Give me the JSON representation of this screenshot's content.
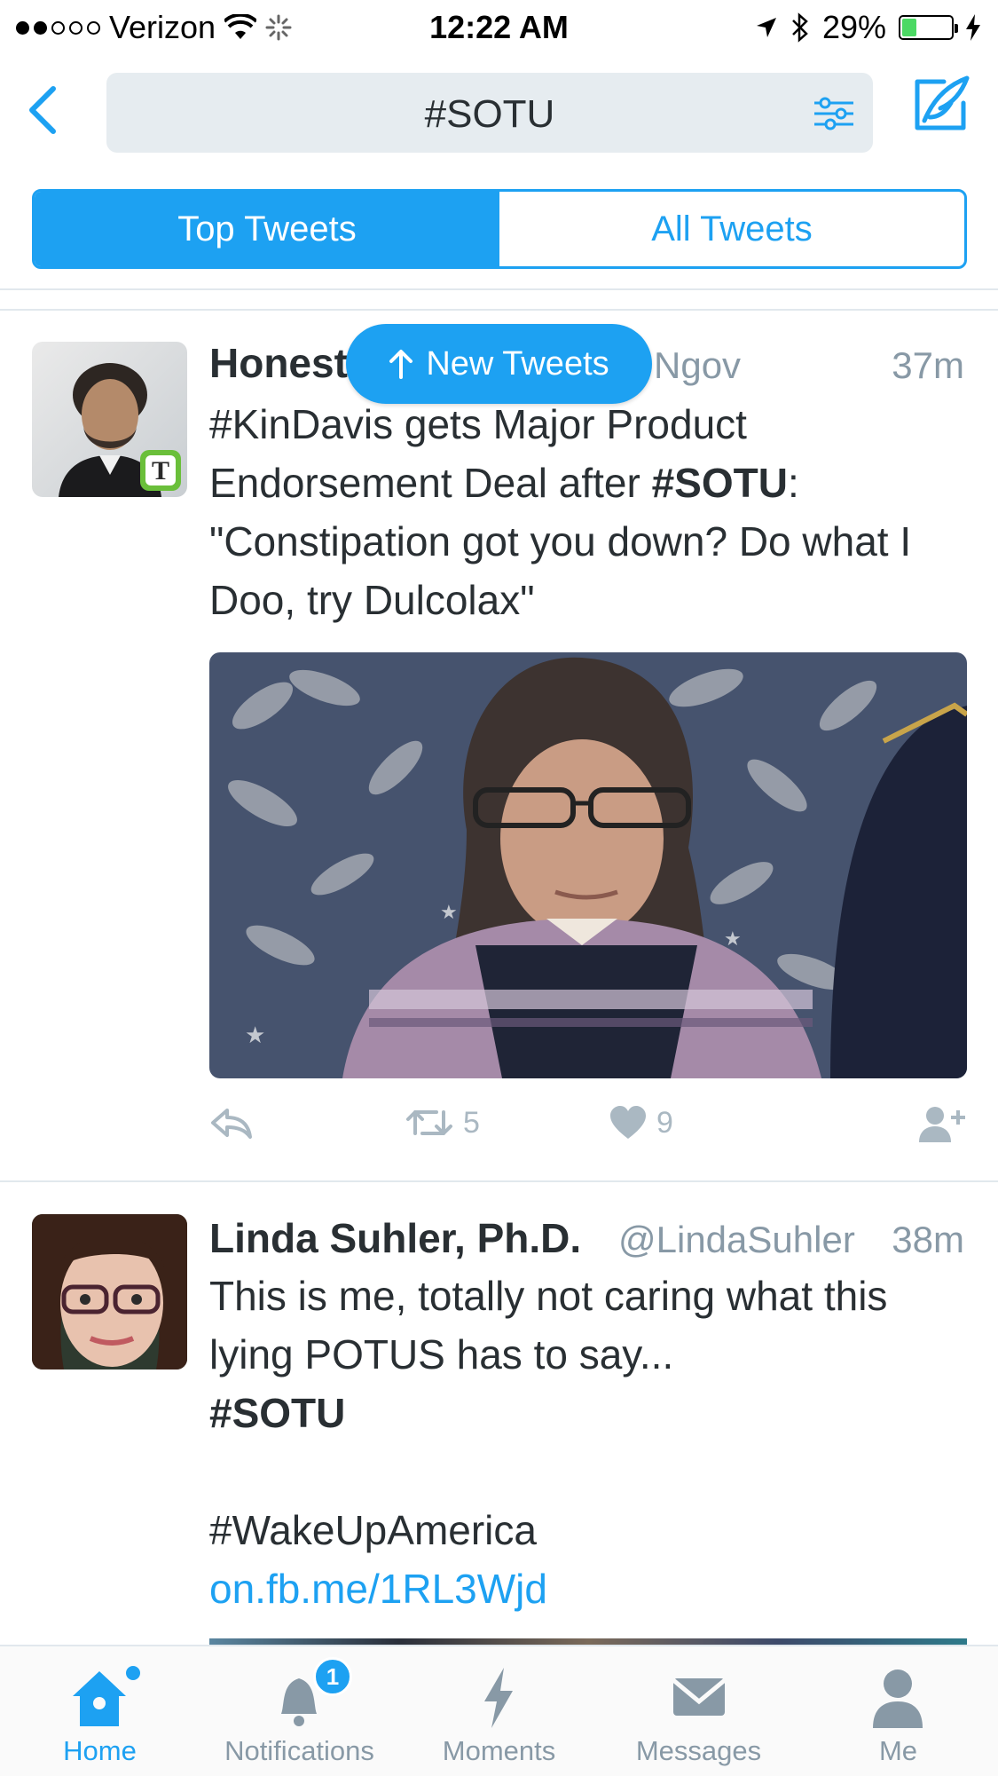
{
  "status_bar": {
    "carrier": "Verizon",
    "time": "12:22 AM",
    "battery": "29%",
    "battery_level": 0.29
  },
  "nav": {
    "search_query": "#SOTU",
    "back_icon": "chevron-left-icon",
    "filter_icon": "sliders-icon",
    "compose_icon": "compose-quill-icon"
  },
  "segments": {
    "top": "Top Tweets",
    "all": "All Tweets"
  },
  "new_tweets_pill": "New Tweets",
  "tweets": [
    {
      "name": "Honest",
      "handle_visible": "Ngov",
      "time": "37m",
      "text_parts": [
        "#KinDavis gets Major Product Endorsement Deal after ",
        "#SOTU",
        ": \"Constipation got you down? Do what I Doo, try Dulcolax\""
      ],
      "retweets": "5",
      "likes": "9"
    },
    {
      "name": "Linda Suhler, Ph.D.",
      "handle": "@LindaSuhler",
      "time": "38m",
      "text_line1": "This is me, totally not caring what this lying POTUS has to say...",
      "hashtag": "#SOTU",
      "hashtag2": "#WakeUpAmerica",
      "link": "on.fb.me/1RL3Wjd"
    }
  ],
  "tabbar": {
    "home": "Home",
    "notifications": "Notifications",
    "notifications_badge": "1",
    "moments": "Moments",
    "messages": "Messages",
    "me": "Me"
  },
  "colors": {
    "accent": "#1da1f2",
    "muted": "#8899a6",
    "text": "#292f33"
  }
}
